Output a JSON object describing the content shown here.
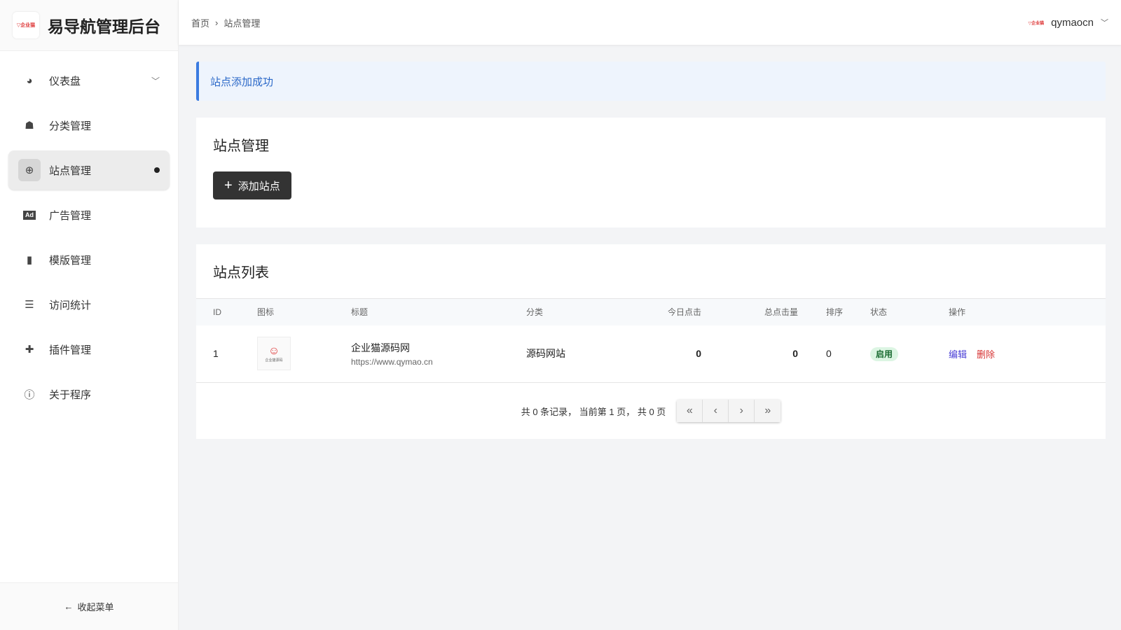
{
  "brand": {
    "title": "易导航管理后台",
    "logo_text": "企业猫"
  },
  "sidebar": {
    "items": [
      {
        "label": "仪表盘",
        "icon": "dashboard-icon"
      },
      {
        "label": "分类管理",
        "icon": "sitemap-icon"
      },
      {
        "label": "站点管理",
        "icon": "globe-icon"
      },
      {
        "label": "广告管理",
        "icon": "ad-icon"
      },
      {
        "label": "模版管理",
        "icon": "file-icon"
      },
      {
        "label": "访问统计",
        "icon": "chart-icon"
      },
      {
        "label": "插件管理",
        "icon": "puzzle-icon"
      },
      {
        "label": "关于程序",
        "icon": "info-icon"
      }
    ],
    "collapse_label": "收起菜单"
  },
  "header": {
    "breadcrumb": [
      "首页",
      "站点管理"
    ],
    "username": "qymaocn",
    "user_logo_text": "企业猫"
  },
  "alert": "站点添加成功",
  "manage": {
    "title": "站点管理",
    "add_label": "添加站点"
  },
  "list": {
    "title": "站点列表",
    "columns": [
      "ID",
      "图标",
      "标题",
      "分类",
      "今日点击",
      "总点击量",
      "排序",
      "状态",
      "操作"
    ],
    "rows": [
      {
        "id": "1",
        "icon_text": "企业猫源码",
        "title": "企业猫源码网",
        "url": "https://www.qymao.cn",
        "category": "源码网站",
        "today": "0",
        "total": "0",
        "sort": "0",
        "status": "启用",
        "edit": "编辑",
        "delete": "删除"
      }
    ]
  },
  "pagination": {
    "summary": "共 0 条记录， 当前第 1 页， 共 0 页"
  }
}
